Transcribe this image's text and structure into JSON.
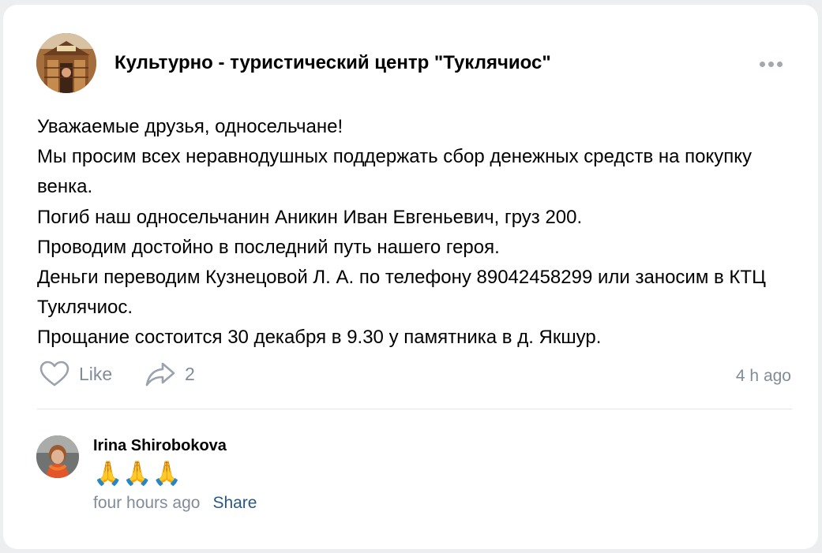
{
  "post": {
    "author": "Культурно - туристический центр \"Туклячиос\"",
    "avatar_icon": "community-avatar-icon",
    "more_icon": "more-icon",
    "paragraphs": [
      "Уважаемые друзья, односельчане!",
      "Мы просим всех неравнодушных поддержать сбор денежных средств на покупку венка.",
      "Погиб наш односельчанин Аникин Иван Евгеньевич, груз 200.",
      "Проводим достойно в последний путь нашего героя.",
      "Деньги переводим Кузнецовой Л. А. по телефону 89042458299 или заносим в КТЦ Туклячиос.",
      "Прощание состоится 30 декабря в 9.30 у памятника в д. Якшур."
    ],
    "actions": {
      "like_label": "Like",
      "like_icon": "heart-icon",
      "share_count": "2",
      "share_icon": "share-arrow-icon"
    },
    "time": "4 h ago"
  },
  "comment": {
    "author": "Irina Shirobokova",
    "avatar_icon": "user-avatar-icon",
    "text": "🙏🙏🙏",
    "time": "four hours ago",
    "share_label": "Share"
  },
  "colors": {
    "background": "#edeef0",
    "card": "#ffffff",
    "muted_text": "#818c99",
    "link": "#2a5885",
    "divider": "#e3e4e8"
  }
}
